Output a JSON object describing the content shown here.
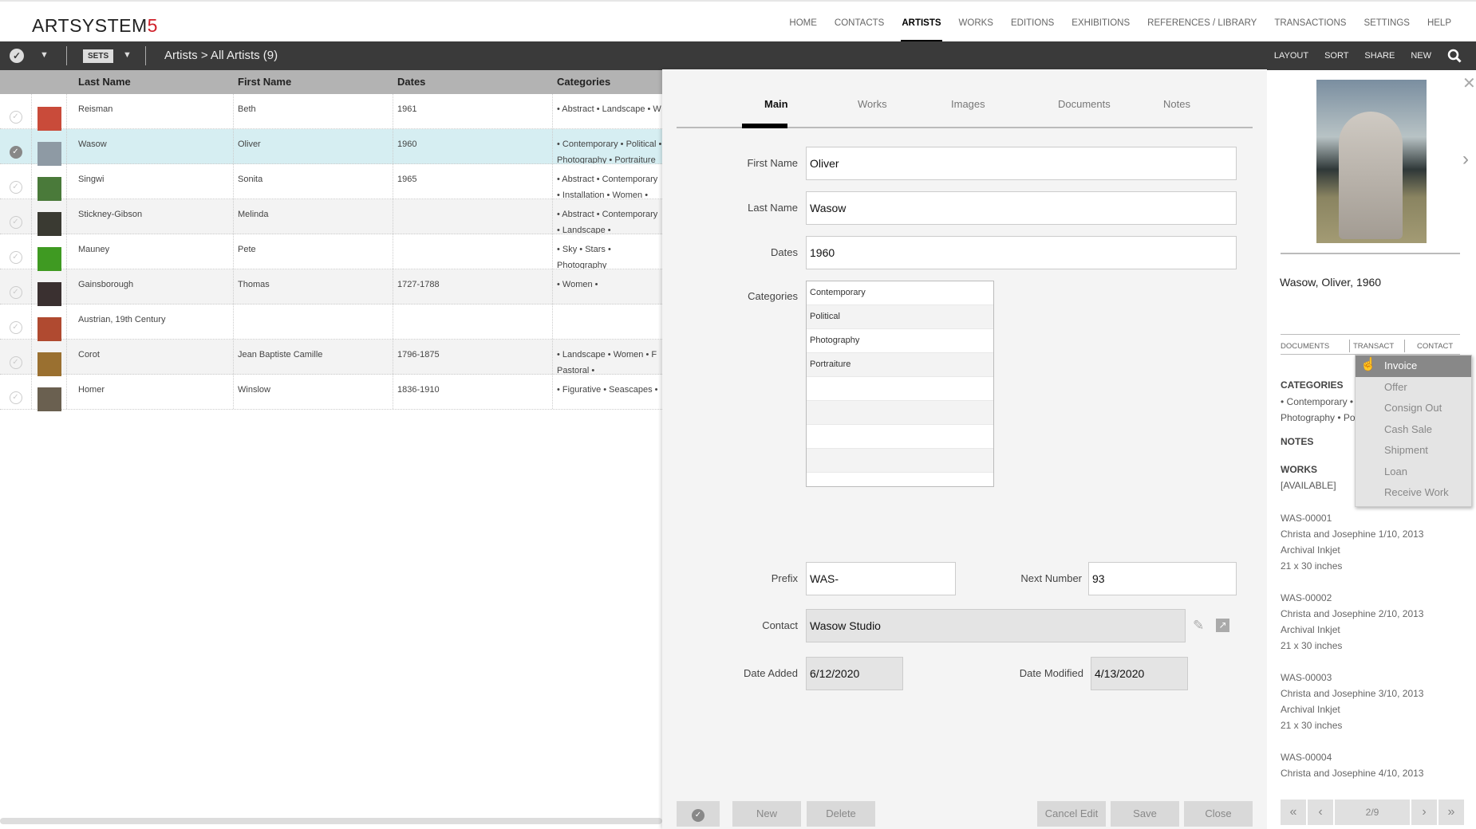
{
  "app": {
    "logo": "ARTSYSTEM",
    "logo_accent": "5"
  },
  "nav": [
    "HOME",
    "CONTACTS",
    "ARTISTS",
    "WORKS",
    "EDITIONS",
    "EXHIBITIONS",
    "REFERENCES / LIBRARY",
    "TRANSACTIONS",
    "SETTINGS",
    "HELP"
  ],
  "nav_active": "ARTISTS",
  "toolbar": {
    "sets": "SETS",
    "breadcrumb": "Artists > All Artists (9)",
    "layout": "LAYOUT",
    "sort": "SORT",
    "share": "SHARE",
    "new": "NEW"
  },
  "table": {
    "headers": [
      "Last Name",
      "First Name",
      "Dates",
      "Categories"
    ],
    "rows": [
      {
        "last": "Reisman",
        "first": "Beth",
        "dates": "1961",
        "cats": "• Abstract • Landscape • W",
        "thumb": "#c94b3a",
        "sel": false
      },
      {
        "last": "Wasow",
        "first": "Oliver",
        "dates": "1960",
        "cats": "• Contemporary • Political • Photography • Portraiture",
        "thumb": "#8e9aa4",
        "sel": true
      },
      {
        "last": "Singwi",
        "first": "Sonita",
        "dates": "1965",
        "cats": "• Abstract • Contemporary • Installation • Women •",
        "thumb": "#4a7a3a",
        "sel": false
      },
      {
        "last": "Stickney-Gibson",
        "first": "Melinda",
        "dates": "",
        "cats": "• Abstract • Contemporary • Landscape •",
        "thumb": "#3a3a32",
        "sel": false
      },
      {
        "last": "Mauney",
        "first": "Pete",
        "dates": "",
        "cats": "• Sky • Stars • Photography",
        "thumb": "#3f9a22",
        "sel": false
      },
      {
        "last": "Gainsborough",
        "first": "Thomas",
        "dates": "1727-1788",
        "cats": "• Women •",
        "thumb": "#3a3030",
        "sel": false
      },
      {
        "last": "Austrian, 19th Century",
        "first": "",
        "dates": "",
        "cats": "",
        "thumb": "#b04a30",
        "sel": false
      },
      {
        "last": "Corot",
        "first": "Jean Baptiste Camille",
        "dates": "1796-1875",
        "cats": "• Landscape • Women • F Pastoral •",
        "thumb": "#9a7030",
        "sel": false
      },
      {
        "last": "Homer",
        "first": "Winslow",
        "dates": "1836-1910",
        "cats": "• Figurative • Seascapes •",
        "thumb": "#6a6050",
        "sel": false
      }
    ]
  },
  "modal": {
    "tabs": [
      "Main",
      "Works",
      "Images",
      "Documents",
      "Notes"
    ],
    "active_tab": "Main",
    "labels": {
      "first": "First Name",
      "last": "Last Name",
      "dates": "Dates",
      "categories": "Categories",
      "prefix": "Prefix",
      "next": "Next Number",
      "contact": "Contact",
      "added": "Date Added",
      "modified": "Date Modified"
    },
    "values": {
      "first": "Oliver",
      "last": "Wasow",
      "dates": "1960",
      "prefix": "WAS-",
      "next": "93",
      "contact": "Wasow Studio",
      "added": "6/12/2020",
      "modified": "4/13/2020"
    },
    "categories": [
      "Contemporary",
      "Political",
      "Photography",
      "Portraiture",
      "",
      "",
      "",
      ""
    ],
    "buttons": {
      "new": "New",
      "delete": "Delete",
      "cancel": "Cancel Edit",
      "save": "Save",
      "close": "Close"
    }
  },
  "side": {
    "title": "Wasow, Oliver, 1960",
    "tabs": [
      "DOCUMENTS",
      "TRANSACT",
      "CONTACT"
    ],
    "categories_h": "CATEGORIES",
    "categories_text": "• Contemporary • Political • Photography • Portraiture",
    "notes_h": "NOTES",
    "works_h": "WORKS",
    "available": "[AVAILABLE]",
    "works": [
      {
        "id": "WAS-00001",
        "title": "Christa and Josephine 1/10, 2013",
        "medium": "Archival Inkjet",
        "size": "21 x 30 inches"
      },
      {
        "id": "WAS-00002",
        "title": "Christa and Josephine 2/10, 2013",
        "medium": "Archival Inkjet",
        "size": "21 x 30 inches"
      },
      {
        "id": "WAS-00003",
        "title": "Christa and Josephine 3/10, 2013",
        "medium": "Archival Inkjet",
        "size": "21 x 30 inches"
      },
      {
        "id": "WAS-00004",
        "title": "Christa and Josephine 4/10, 2013",
        "medium": "",
        "size": ""
      }
    ],
    "pager": "2/9",
    "dropdown": [
      "Invoice",
      "Offer",
      "Consign Out",
      "Cash Sale",
      "Shipment",
      "Loan",
      "Receive Work"
    ],
    "dropdown_hover": "Invoice"
  }
}
